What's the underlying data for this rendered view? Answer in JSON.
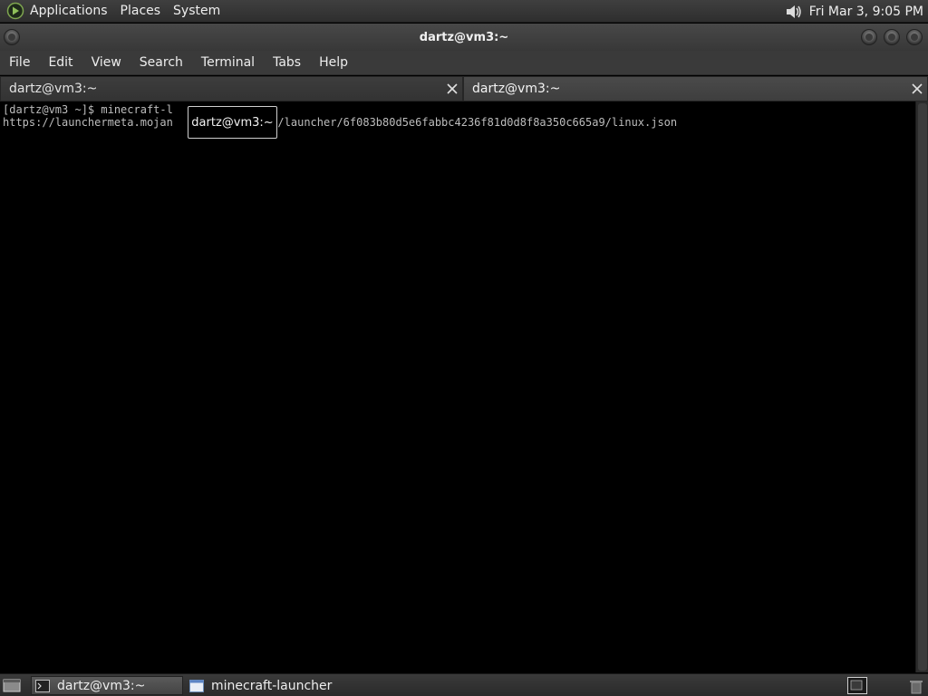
{
  "top_panel": {
    "menus": [
      "Applications",
      "Places",
      "System"
    ],
    "clock": "Fri Mar  3,  9:05 PM"
  },
  "window": {
    "title": "dartz@vm3:~"
  },
  "menubar": {
    "items": [
      "File",
      "Edit",
      "View",
      "Search",
      "Terminal",
      "Tabs",
      "Help"
    ]
  },
  "tabs": [
    {
      "label": "dartz@vm3:~"
    },
    {
      "label": "dartz@vm3:~"
    }
  ],
  "terminal": {
    "lines": [
      "[dartz@vm3 ~]$ minecraft-l",
      "https://launchermeta.mojan           ducts/launcher/6f083b80d5e6fabbc4236f81d0d8f8a350c665a9/linux.json"
    ]
  },
  "tooltip": {
    "text": "dartz@vm3:~"
  },
  "taskbar": {
    "tasks": [
      {
        "label": "dartz@vm3:~",
        "icon": "terminal-icon"
      },
      {
        "label": "minecraft-launcher",
        "icon": "window-icon"
      }
    ]
  },
  "colors": {
    "terminal_bg": "#000000",
    "terminal_fg": "#bdbdbd",
    "panel_bg": "#333333"
  }
}
